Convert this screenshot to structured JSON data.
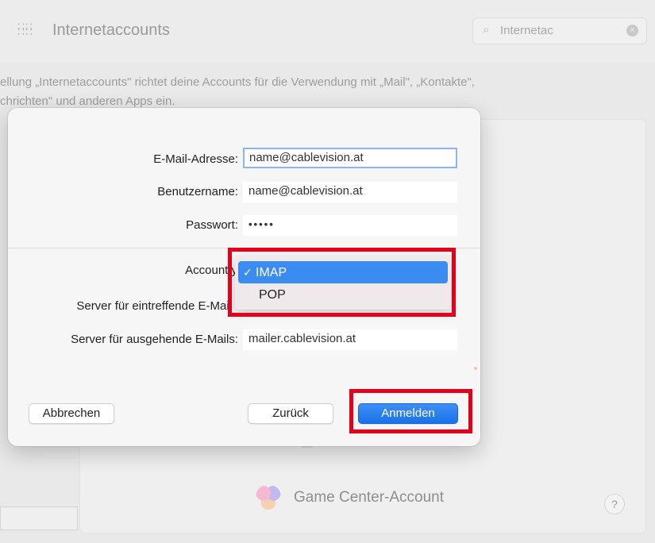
{
  "background": {
    "window_title": "Internetaccounts",
    "search_value": "Internetac",
    "description_line1": "ellung „Internetaccounts\" richtet deine Accounts für die Verwendung mit „Mail\", „Kontakte\",",
    "description_line2": "chrichten\" und anderen Apps ein.",
    "game_center_label": "Game Center-Account",
    "help_glyph": "?"
  },
  "dialog": {
    "email_label": "E-Mail-Adresse:",
    "email_value": "name@cablevision.at",
    "username_label": "Benutzername:",
    "username_value": "name@cablevision.at",
    "password_label": "Passwort:",
    "password_value": "•••••",
    "account_type_label": "Accountty",
    "incoming_label": "Server für eintreffende E-Mail",
    "outgoing_label": "Server für ausgehende E-Mails:",
    "outgoing_value": "mailer.cablevision.at",
    "cancel_label": "Abbrechen",
    "back_label": "Zurück",
    "login_label": "Anmelden"
  },
  "account_type_menu": {
    "options": [
      "IMAP",
      "POP"
    ],
    "selected": "IMAP",
    "check_glyph": "✓"
  },
  "colors": {
    "highlight": "#e3001b",
    "accent": "#1a72e8"
  }
}
